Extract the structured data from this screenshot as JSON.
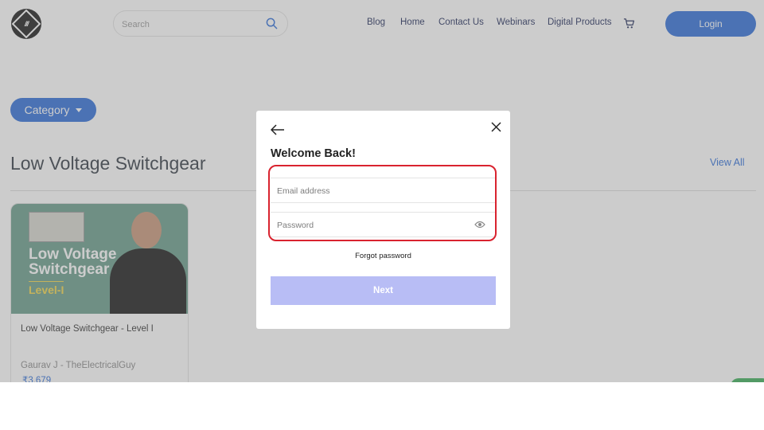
{
  "header": {
    "search_placeholder": "Search",
    "nav": [
      "Blog",
      "Home",
      "Contact Us",
      "Webinars",
      "Digital Products"
    ],
    "login_label": "Login"
  },
  "page": {
    "category_label": "Category",
    "section_title": "Low Voltage Switchgear",
    "view_all_label": "View All"
  },
  "course_card": {
    "thumbnail_line1": "Low Voltage",
    "thumbnail_line2": "Switchgear",
    "thumbnail_level": "Level-I",
    "title": "Low Voltage Switchgear - Level I",
    "author": "Gaurav J - TheElectricalGuy",
    "price": "₹3,679"
  },
  "login_modal": {
    "heading": "Welcome Back!",
    "email_placeholder": "Email address",
    "password_placeholder": "Password",
    "forgot_label": "Forgot password",
    "next_label": "Next"
  },
  "colors": {
    "accent": "#2f6fd8",
    "next_button_disabled": "#b8bdf5",
    "highlight_border": "#d9232f"
  }
}
